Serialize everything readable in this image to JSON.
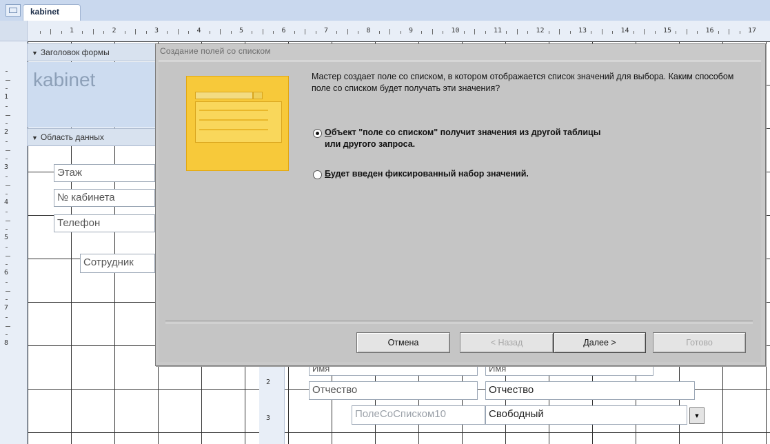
{
  "tab": {
    "label": "kabinet"
  },
  "ruler": {
    "top": [
      "1",
      "2",
      "3",
      "4",
      "5",
      "6",
      "7",
      "8",
      "9",
      "10",
      "11",
      "12",
      "13",
      "14",
      "15",
      "16",
      "17"
    ],
    "left": [
      "1",
      "2",
      "3",
      "4",
      "5",
      "6",
      "7",
      "8"
    ],
    "left_lower": [
      "2",
      "3"
    ]
  },
  "form": {
    "header_band": "Заголовок формы",
    "header_title": "kabinet",
    "detail_band": "Область данных",
    "fields": {
      "floor": "Этаж",
      "room_no": "№ кабинета",
      "phone": "Телефон",
      "employee": "Сотрудник",
      "name_label": "Имя",
      "name_value": "Имя",
      "patronymic_label": "Отчество",
      "patronymic_value": "Отчество",
      "combo_label": "ПолеСоСписком10",
      "combo_value": "Свободный"
    }
  },
  "dialog": {
    "title": "Создание полей со списком",
    "intro": "Мастер создает поле со списком, в котором отображается список значений для выбора.  Каким способом поле со списком будет получать эти значения?",
    "option1_accel": "О",
    "option1_rest": "бъект \"поле со списком\" получит значения из другой таблицы или другого запроса.",
    "option2_accel": "Б",
    "option2_rest": "удет введен фиксированный набор значений.",
    "buttons": {
      "cancel": "Отмена",
      "back": "< Назад",
      "next": "Далее >",
      "finish": "Готово"
    }
  },
  "colors": {
    "tabstrip": "#c9d8ee",
    "dialog_bg": "#c5c5c5",
    "illustration": "#f7c93a"
  }
}
